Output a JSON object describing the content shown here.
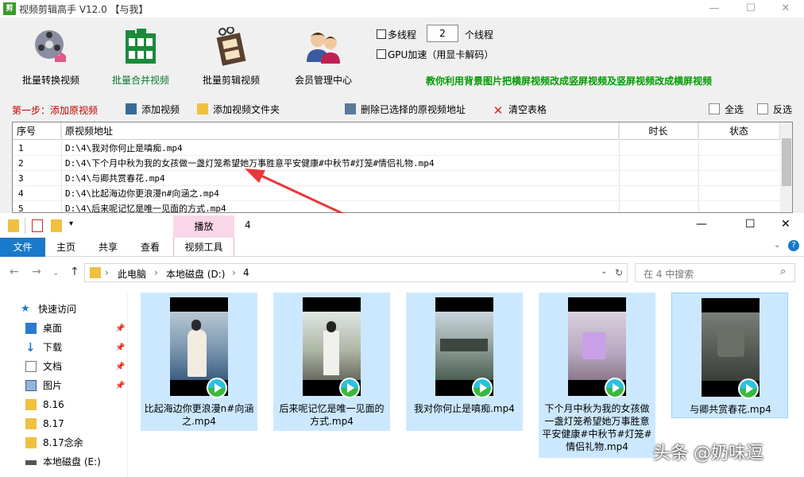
{
  "app": {
    "title": "视频剪辑高手 V12.0  【与我】",
    "window_controls": {
      "minimize": "—",
      "maximize": "☐",
      "close": "✕"
    },
    "big_buttons": [
      {
        "label": "批量转换视频",
        "icon": "film-reel-icon"
      },
      {
        "label": "批量合并视频",
        "icon": "merge-film-icon"
      },
      {
        "label": "批量剪辑视频",
        "icon": "cut-film-icon"
      },
      {
        "label": "会员管理中心",
        "icon": "users-icon"
      }
    ],
    "multithread_label": "多线程",
    "thread_count": "2",
    "thread_unit": "个线程",
    "gpu_label": "GPU加速（用显卡解码）",
    "tip": "教你利用背景图片把横屏视频改成竖屏视频及竖屏视频改成横屏视频",
    "step_label": "第一步：添加原视频",
    "toolbar": {
      "add_video": "添加视频",
      "add_folder": "添加视频文件夹",
      "delete_selected": "删除已选择的原视频地址",
      "clear_table": "清空表格",
      "select_all": "全选",
      "invert": "反选"
    },
    "table": {
      "columns": [
        "序号",
        "原视频地址",
        "时长",
        "状态"
      ],
      "rows": [
        {
          "no": "1",
          "path": "D:\\4\\我对你何止是嗔痴.mp4"
        },
        {
          "no": "2",
          "path": "D:\\4\\下个月中秋为我的女孩做一盏灯笼希望她万事胜意平安健康#中秋节#灯笼#情侣礼物.mp4"
        },
        {
          "no": "3",
          "path": "D:\\4\\与卿共赏春花.mp4"
        },
        {
          "no": "4",
          "path": "D:\\4\\比起海边你更浪漫n#向涵之.mp4"
        },
        {
          "no": "5",
          "path": "D:\\4\\后来呢记忆是唯一见面的方式.mp4"
        }
      ]
    }
  },
  "explorer": {
    "folder_title": "4",
    "contextual_tab": "播放",
    "tabs": [
      "文件",
      "主页",
      "共享",
      "查看",
      "视频工具"
    ],
    "breadcrumb": [
      "此电脑",
      "本地磁盘 (D:)",
      "4"
    ],
    "search_placeholder": "在 4 中搜索",
    "nav": [
      {
        "label": "快速访问",
        "icon": "star-icon"
      },
      {
        "label": "桌面",
        "icon": "desktop-icon",
        "pinned": true
      },
      {
        "label": "下载",
        "icon": "download-icon",
        "pinned": true
      },
      {
        "label": "文档",
        "icon": "document-icon",
        "pinned": true
      },
      {
        "label": "图片",
        "icon": "picture-icon",
        "pinned": true
      },
      {
        "label": "8.16",
        "icon": "folder-icon"
      },
      {
        "label": "8.17",
        "icon": "folder-icon"
      },
      {
        "label": "8.17念余",
        "icon": "folder-icon"
      },
      {
        "label": "本地磁盘 (E:)",
        "icon": "drive-icon"
      }
    ],
    "files": [
      {
        "name": "比起海边你更浪漫n#向涵之.mp4"
      },
      {
        "name": "后来呢记忆是唯一见面的方式.mp4"
      },
      {
        "name": "我对你何止是嗔痴.mp4"
      },
      {
        "name": "下个月中秋为我的女孩做一盏灯笼希望她万事胜意平安健康#中秋节#灯笼#情侣礼物.mp4"
      },
      {
        "name": "与卿共赏春花.mp4"
      }
    ]
  },
  "watermark": "头条 @奶味逗"
}
